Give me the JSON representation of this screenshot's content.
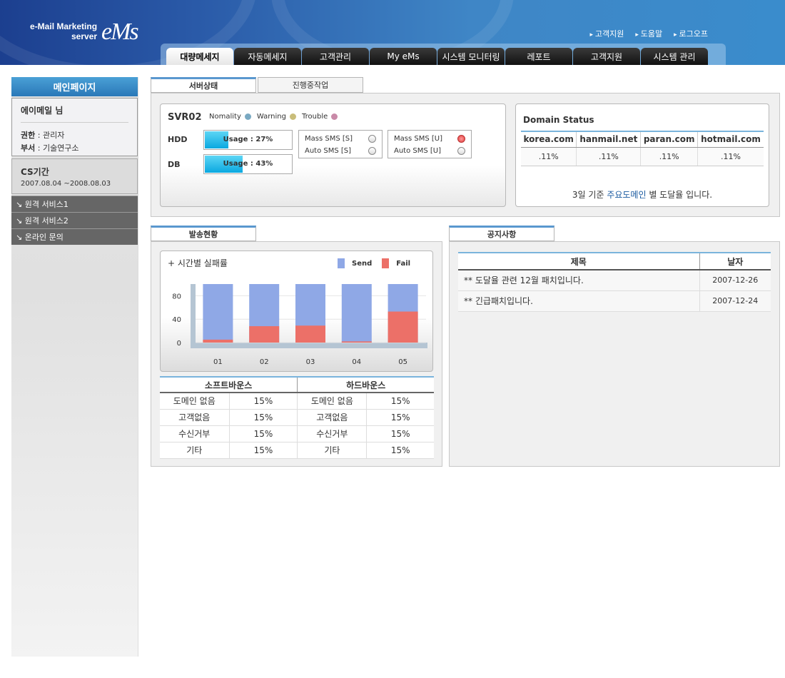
{
  "header": {
    "logo_line1": "e-Mail Marketing",
    "logo_line2": "server",
    "logo_brand": "eMs",
    "links": [
      "고객지원",
      "도움말",
      "로그오프"
    ],
    "tabs": [
      "대량메세지",
      "자동메세지",
      "고객관리",
      "My eMs",
      "시스템 모니터링",
      "레포트",
      "고객지원",
      "시스템 관리"
    ],
    "active_tab": 0
  },
  "sidebar": {
    "title": "메인페이지",
    "user_name": "에이메일 님",
    "role_label": "권한",
    "role_value": ": 관리자",
    "dept_label": "부서",
    "dept_value": ": 기술연구소",
    "cs_title": "CS기간",
    "cs_period": "2007.08.04 ~2008.08.03",
    "links": [
      "원격 서비스1",
      "원격 서비스2",
      "온라인 문의"
    ]
  },
  "server": {
    "tabs": [
      "서버상태",
      "진행중작업"
    ],
    "name": "SVR02",
    "legend": [
      {
        "label": "Nomality",
        "color": "#7aa9c2"
      },
      {
        "label": "Warning",
        "color": "#c9bd7a"
      },
      {
        "label": "Trouble",
        "color": "#c98aa8"
      }
    ],
    "hdd_label": "HDD",
    "hdd_usage_text": "Usage : 27%",
    "hdd_usage": 27,
    "db_label": "DB",
    "db_usage_text": "Usage : 43%",
    "db_usage": 43,
    "sms_s": [
      "Mass SMS [S]",
      "Auto SMS [S]"
    ],
    "sms_u": [
      "Mass SMS [U]",
      "Auto SMS [U]"
    ]
  },
  "domain": {
    "title": "Domain Status",
    "columns": [
      "korea.com",
      "hanmail.net",
      "paran.com",
      "hotmail.com"
    ],
    "values": [
      ".11%",
      ".11%",
      ".11%",
      ".11%"
    ],
    "note_pre": "3일 기준 ",
    "note_hl": "주요도메인",
    "note_post": " 별 도달율 입니다."
  },
  "send": {
    "tab": "발송현황",
    "bounce_headers": [
      "소프트바운스",
      "하드바운스"
    ],
    "bounce_rows": [
      [
        "도메인 없음",
        "15%",
        "도메인 없음",
        "15%"
      ],
      [
        "고객없음",
        "15%",
        "고객없음",
        "15%"
      ],
      [
        "수신거부",
        "15%",
        "수신거부",
        "15%"
      ],
      [
        "기타",
        "15%",
        "기타",
        "15%"
      ]
    ]
  },
  "chart_data": {
    "type": "bar",
    "title": "+ 시간별 실패률",
    "categories": [
      "01",
      "02",
      "03",
      "04",
      "05"
    ],
    "series": [
      {
        "name": "Send",
        "color": "#8fa8e6",
        "values": [
          100,
          100,
          100,
          100,
          100
        ]
      },
      {
        "name": "Fail",
        "color": "#ec7068",
        "values": [
          5,
          28,
          29,
          2,
          53
        ]
      }
    ],
    "yticks": [
      0,
      40,
      80
    ],
    "ylim": [
      0,
      100
    ],
    "stacked_overlay": true
  },
  "notice": {
    "tab": "공지사항",
    "headers": [
      "제목",
      "날자"
    ],
    "rows": [
      {
        "title": "** 도달율 관련 12월 패치입니다.",
        "date": "2007-12-26"
      },
      {
        "title": "** 긴급패치입니다.",
        "date": "2007-12-24"
      }
    ]
  }
}
